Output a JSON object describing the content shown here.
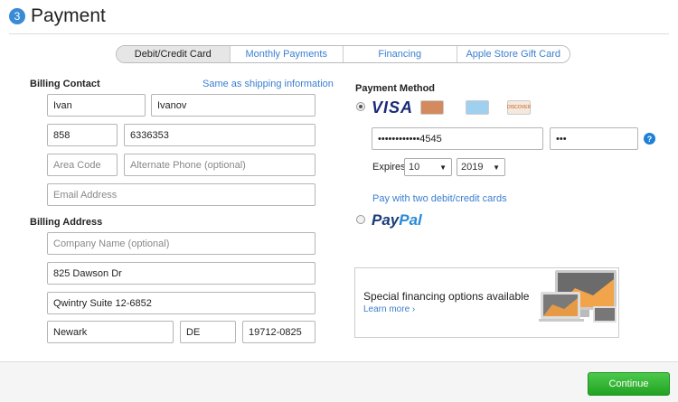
{
  "header": {
    "step_number": "3",
    "title": "Payment"
  },
  "tabs": [
    {
      "label": "Debit/Credit Card",
      "active": true
    },
    {
      "label": "Monthly Payments",
      "active": false
    },
    {
      "label": "Financing",
      "active": false
    },
    {
      "label": "Apple Store Gift Card",
      "active": false
    }
  ],
  "billing_contact": {
    "label": "Billing Contact",
    "shipping_link": "Same as shipping information",
    "first_name": "Ivan",
    "last_name": "Ivanov",
    "area_code": "858",
    "phone": "6336353",
    "alt_area_code_placeholder": "Area Code",
    "alt_phone_placeholder": "Alternate Phone (optional)",
    "email_placeholder": "Email Address"
  },
  "billing_address": {
    "label": "Billing Address",
    "company_placeholder": "Company Name (optional)",
    "street": "825 Dawson Dr",
    "street2": "Qwintry Suite 12-6852",
    "city": "Newark",
    "state": "DE",
    "zip": "19712-0825"
  },
  "payment_method": {
    "label": "Payment Method",
    "visa_text": "VISA",
    "card_number": "••••••••••••4545",
    "cvv": "•••",
    "help_icon_text": "?",
    "expires_label": "Expires",
    "expire_month": "10",
    "expire_year": "2019",
    "split_link": "Pay with two debit/credit cards",
    "paypal_pay": "Pay",
    "paypal_pal": "Pal"
  },
  "promo": {
    "title": "Special financing options available",
    "link": "Learn more ›"
  },
  "footer": {
    "continue_label": "Continue"
  },
  "colors": {
    "accent": "#3a7fd0",
    "continue": "#22a322",
    "step_badge": "#3a8bd6"
  }
}
